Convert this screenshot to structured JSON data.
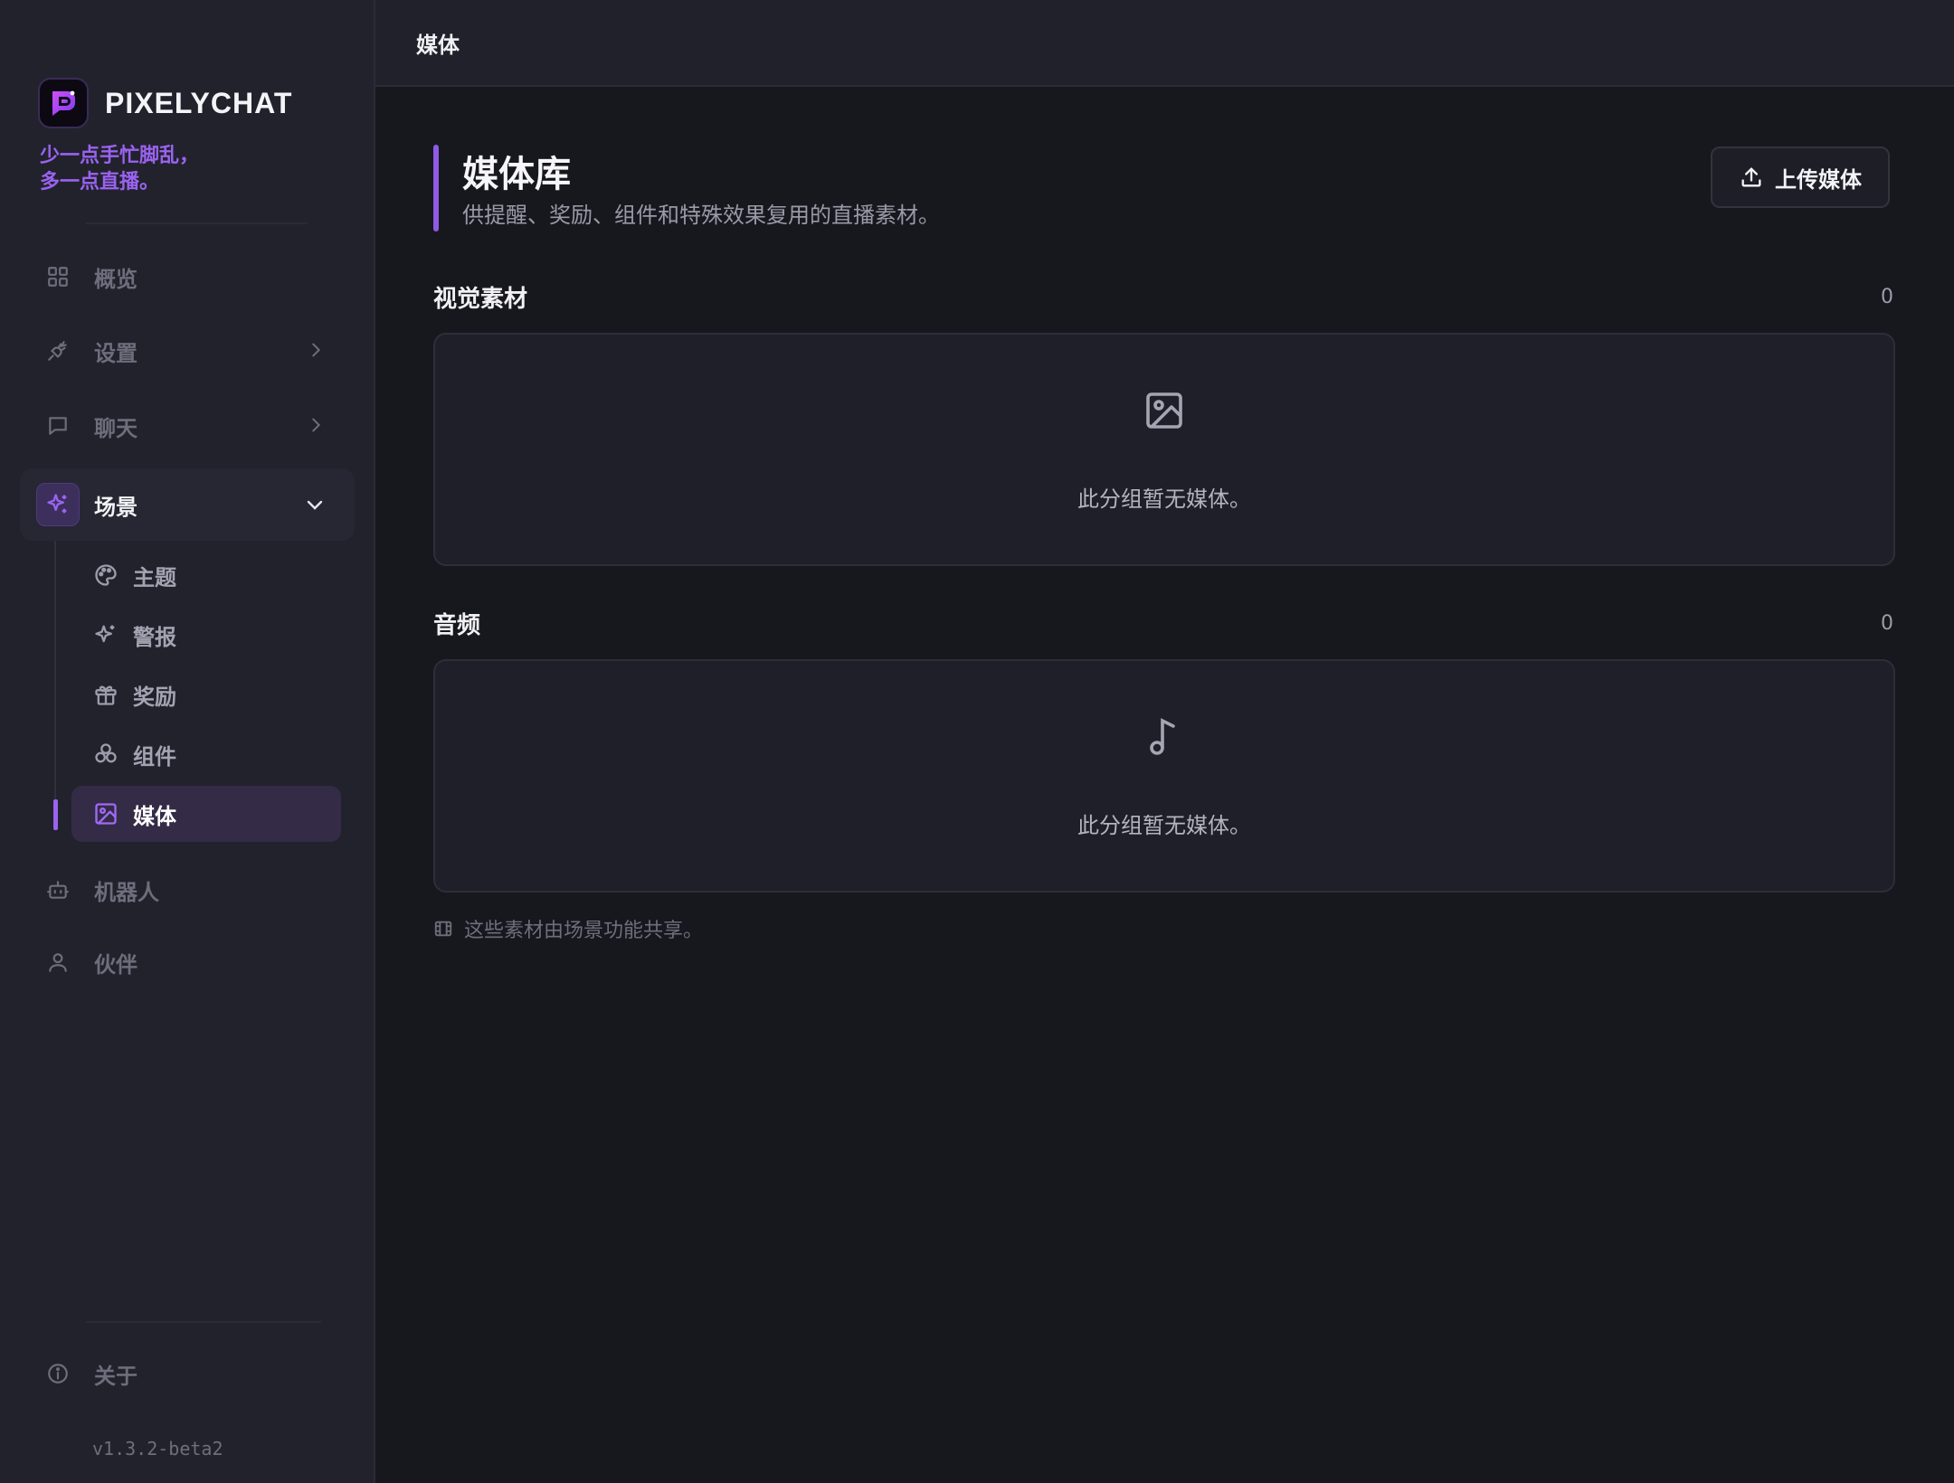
{
  "brand": {
    "name": "PIXELYCHAT",
    "tagline": "少一点手忙脚乱，\n多一点直播。",
    "accent_color": "#9a63f0"
  },
  "nav": {
    "items": [
      {
        "label": "概览",
        "icon": "grid-icon"
      },
      {
        "label": "设置",
        "icon": "plug-icon"
      },
      {
        "label": "聊天",
        "icon": "chat-bubble-icon"
      },
      {
        "label": "场景",
        "icon": "sparkles-icon",
        "expanded": true
      },
      {
        "label": "机器人",
        "icon": "bot-icon"
      },
      {
        "label": "伙伴",
        "icon": "user-icon"
      }
    ],
    "scene_children": [
      {
        "label": "主题",
        "icon": "palette-icon"
      },
      {
        "label": "警报",
        "icon": "sparkles-icon"
      },
      {
        "label": "奖励",
        "icon": "gift-icon"
      },
      {
        "label": "组件",
        "icon": "components-icon"
      },
      {
        "label": "媒体",
        "icon": "image-icon",
        "active": true
      }
    ],
    "about": {
      "label": "关于",
      "icon": "info-icon"
    }
  },
  "version": "v1.3.2-beta2",
  "topbar": {
    "breadcrumb": "媒体"
  },
  "page": {
    "title": "媒体库",
    "subtitle": "供提醒、奖励、组件和特殊效果复用的直播素材。",
    "upload_label": "上传媒体"
  },
  "sections": [
    {
      "title": "视觉素材",
      "count": "0",
      "empty_text": "此分组暂无媒体。",
      "icon": "image-icon"
    },
    {
      "title": "音频",
      "count": "0",
      "empty_text": "此分组暂无媒体。",
      "icon": "music-note-icon"
    }
  ],
  "footer_note": "这些素材由场景功能共享。"
}
